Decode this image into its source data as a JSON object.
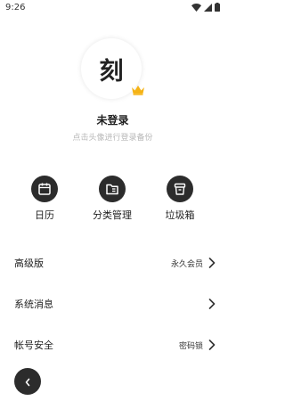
{
  "status_bar": {
    "time": "9:26",
    "icons": [
      "wifi-icon",
      "signal-icon",
      "battery-icon"
    ]
  },
  "profile": {
    "avatar_text": "刻",
    "name": "未登录",
    "hint": "点击头像进行登录备份",
    "badge_icon": "crown-icon",
    "badge_color": "#f5b316"
  },
  "quick_actions": [
    {
      "label": "日历",
      "icon": "calendar-icon"
    },
    {
      "label": "分类管理",
      "icon": "folder-icon"
    },
    {
      "label": "垃圾箱",
      "icon": "trash-icon"
    }
  ],
  "menu": [
    {
      "title": "高级版",
      "value": "永久会员"
    },
    {
      "title": "系统消息",
      "value": ""
    },
    {
      "title": "帐号安全",
      "value": "密码锁"
    }
  ],
  "back_button": {
    "icon": "chevron-left-icon"
  },
  "colors": {
    "accent_dark": "#2c2c2c",
    "background": "#ffffff",
    "hint_text": "#b8b8b8"
  }
}
